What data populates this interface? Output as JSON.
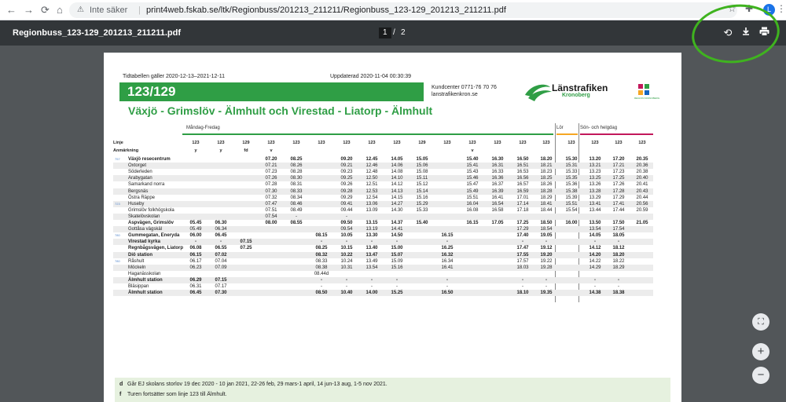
{
  "browser": {
    "back_icon": "←",
    "forward_icon": "→",
    "reload_icon": "⟳",
    "home_icon": "⌂",
    "security_label": "Inte säker",
    "url": "print4web.fskab.se/ltk/Regionbuss/201213_211211/Regionbuss_123-129_201213_211211.pdf",
    "profile_initial": "L"
  },
  "pdf": {
    "title": "Regionbuss_123-129_201213_211211.pdf",
    "page": "1",
    "separator": "/",
    "total": "2"
  },
  "doc": {
    "valid": "Tidtabellen gäller 2020-12-13–2021-12-11",
    "updated": "Uppdaterad 2020-11-04 00:30:39",
    "route": "123/129",
    "title": "Växjö - Grimslöv - Älmhult och Virestad - Liatorp - Älmhult",
    "kundcenter": "Kundcenter 0771-76 70 76",
    "website": "lanstrafikenkron.se",
    "brand": "Länstrafiken",
    "brand_sub": "Kronoberg",
    "region_text": "REGION KRONOBERG",
    "days": [
      "Måndag-Fredag",
      "Lör",
      "Sön- och helgdag"
    ],
    "linje_label": "Linje",
    "anm_label": "Anmärkning",
    "line_numbers": [
      "123",
      "123",
      "129",
      "123",
      "123",
      "123",
      "123",
      "123",
      "123",
      "129",
      "123",
      "123",
      "123",
      "123",
      "123",
      "123",
      "123",
      "123",
      "123"
    ],
    "remarks": [
      "y",
      "y",
      "fd",
      "v",
      "",
      "",
      "",
      "",
      "",
      "",
      "",
      "v",
      "",
      "",
      "",
      "",
      "",
      "",
      ""
    ],
    "stops": [
      {
        "zone": "757",
        "name": "Växjö resecentrum",
        "bold": true,
        "t": [
          "",
          "",
          "",
          "07.20",
          "08.25",
          "",
          "09.20",
          "12.45",
          "14.05",
          "15.05",
          "",
          "15.40",
          "16.30",
          "16.50",
          "18.20",
          "15.30",
          "13.20",
          "17.20",
          "20.35"
        ]
      },
      {
        "zone": "",
        "name": "Oxtorget",
        "bold": false,
        "t": [
          "",
          "",
          "",
          "07.21",
          "08.26",
          "",
          "09.21",
          "12.46",
          "14.06",
          "15.06",
          "",
          "15.41",
          "16.31",
          "16.51",
          "18.21",
          "15.31",
          "13.21",
          "17.21",
          "20.36"
        ]
      },
      {
        "zone": "",
        "name": "Söderleden",
        "bold": false,
        "t": [
          "",
          "",
          "",
          "07.23",
          "08.28",
          "",
          "09.23",
          "12.48",
          "14.08",
          "15.08",
          "",
          "15.43",
          "16.33",
          "16.53",
          "18.23",
          "15.33",
          "13.23",
          "17.23",
          "20.38"
        ]
      },
      {
        "zone": "",
        "name": "Arabygatan",
        "bold": false,
        "t": [
          "",
          "",
          "",
          "07.26",
          "08.30",
          "",
          "09.25",
          "12.50",
          "14.10",
          "15.11",
          "",
          "15.46",
          "16.36",
          "16.56",
          "18.25",
          "15.35",
          "13.25",
          "17.25",
          "20.40"
        ]
      },
      {
        "zone": "",
        "name": "Samarkand norra",
        "bold": false,
        "t": [
          "",
          "",
          "",
          "07.28",
          "08.31",
          "",
          "09.26",
          "12.51",
          "14.12",
          "15.12",
          "",
          "15.47",
          "16.37",
          "16.57",
          "18.26",
          "15.36",
          "13.26",
          "17.26",
          "20.41"
        ]
      },
      {
        "zone": "",
        "name": "Bergsnäs",
        "bold": false,
        "t": [
          "",
          "",
          "",
          "07.30",
          "08.33",
          "",
          "09.28",
          "12.53",
          "14.13",
          "15.14",
          "",
          "15.49",
          "16.39",
          "16.59",
          "18.28",
          "15.38",
          "13.28",
          "17.28",
          "20.43"
        ]
      },
      {
        "zone": "",
        "name": "Östra Räppe",
        "bold": false,
        "t": [
          "",
          "",
          "",
          "07.32",
          "08.34",
          "",
          "09.29",
          "12.54",
          "14.15",
          "15.16",
          "",
          "15.51",
          "16.41",
          "17.01",
          "18.29",
          "15.39",
          "13.29",
          "17.29",
          "20.44"
        ]
      },
      {
        "zone": "723",
        "name": "Huseby",
        "bold": false,
        "t": [
          "",
          "",
          "",
          "07.47",
          "08.46",
          "",
          "09.41",
          "13.06",
          "14.27",
          "15.29",
          "",
          "16.04",
          "16.54",
          "17.14",
          "18.41",
          "15.51",
          "13.41",
          "17.41",
          "20.56"
        ]
      },
      {
        "zone": "",
        "name": "Grimslöv folkhögskola",
        "bold": false,
        "t": [
          "",
          "",
          "",
          "07.51",
          "08.49",
          "",
          "09.44",
          "13.09",
          "14.30",
          "15.33",
          "",
          "16.08",
          "16.58",
          "17.18",
          "18.44",
          "15.54",
          "13.44",
          "17.44",
          "20.59"
        ]
      },
      {
        "zone": "",
        "name": "Skatelövskolan",
        "bold": false,
        "t": [
          "",
          "",
          "",
          "07.54",
          "-",
          "",
          "-",
          "",
          "",
          "",
          "",
          "",
          "",
          "",
          "",
          "",
          "",
          "",
          ""
        ]
      },
      {
        "zone": "",
        "name": "Aspvägen, Grimslöv",
        "bold": true,
        "t": [
          "05.45",
          "06.30",
          "",
          "08.00",
          "08.55",
          "",
          "09.50",
          "13.15",
          "14.37",
          "15.40",
          "",
          "16.15",
          "17.05",
          "17.25",
          "18.50",
          "16.00",
          "13.50",
          "17.50",
          "21.05"
        ]
      },
      {
        "zone": "",
        "name": "Gottåsa vägskäl",
        "bold": false,
        "t": [
          "05.49",
          "06.34",
          "",
          "",
          "",
          "",
          "09.54",
          "13.19",
          "14.41",
          "",
          "",
          "",
          "",
          "17.29",
          "18.54",
          "",
          "13.54",
          "17.54",
          ""
        ]
      },
      {
        "zone": "780",
        "name": "Gummegatan, Eneryda",
        "bold": true,
        "t": [
          "06.00",
          "06.45",
          "",
          "",
          "",
          "08.15",
          "10.05",
          "13.30",
          "14.50",
          "",
          "16.15",
          "",
          "",
          "17.40",
          "19.05",
          "",
          "14.05",
          "18.05",
          ""
        ]
      },
      {
        "zone": "",
        "name": "Virestad kyrka",
        "bold": true,
        "t": [
          "-",
          "-",
          "07.15",
          "",
          "",
          "-",
          "-",
          "-",
          "-",
          "",
          "-",
          "",
          "",
          "-",
          "-",
          "",
          "-",
          "-",
          ""
        ]
      },
      {
        "zone": "",
        "name": "Regnbågsvägen, Liatorp",
        "bold": true,
        "t": [
          "06.08",
          "06.55",
          "07.25",
          "",
          "",
          "08.25",
          "10.15",
          "13.40",
          "15.00",
          "",
          "16.25",
          "",
          "",
          "17.47",
          "19.12",
          "",
          "14.12",
          "18.12",
          ""
        ]
      },
      {
        "zone": "",
        "name": "Diö station",
        "bold": true,
        "t": [
          "06.15",
          "07.02",
          "",
          "",
          "",
          "08.32",
          "10.22",
          "13.47",
          "15.07",
          "",
          "16.32",
          "",
          "",
          "17.55",
          "19.20",
          "",
          "14.20",
          "18.20",
          ""
        ]
      },
      {
        "zone": "780",
        "name": "Råshult",
        "bold": false,
        "t": [
          "06.17",
          "07.04",
          "",
          "",
          "",
          "08.33",
          "10.24",
          "13.49",
          "15.09",
          "",
          "16.34",
          "",
          "",
          "17.57",
          "19.22",
          "",
          "14.22",
          "18.22",
          ""
        ]
      },
      {
        "zone": "",
        "name": "Möckeln",
        "bold": false,
        "t": [
          "06.23",
          "07.09",
          "",
          "",
          "",
          "08.38",
          "10.31",
          "13.54",
          "15.16",
          "",
          "16.41",
          "",
          "",
          "18.03",
          "19.28",
          "",
          "14.29",
          "18.29",
          ""
        ]
      },
      {
        "zone": "",
        "name": "Haganässkolan",
        "bold": false,
        "t": [
          "",
          "",
          "",
          "",
          "",
          "08.44d",
          "",
          "",
          "",
          "",
          "",
          "",
          "",
          "",
          "",
          "",
          "",
          "",
          ""
        ]
      },
      {
        "zone": "",
        "name": "Älmhult station",
        "bold": true,
        "t": [
          "06.29",
          "07.15",
          "",
          "",
          "",
          "-",
          "-",
          "-",
          "-",
          "",
          "-",
          "",
          "",
          "-",
          "-",
          "",
          "-",
          "-",
          ""
        ]
      },
      {
        "zone": "",
        "name": "Bläsippan",
        "bold": false,
        "t": [
          "06.31",
          "07.17",
          "",
          "",
          "",
          "-",
          "-",
          "-",
          "-",
          "",
          "-",
          "",
          "",
          "-",
          "-",
          "",
          "-",
          "-",
          ""
        ]
      },
      {
        "zone": "",
        "name": "Älmhult station",
        "bold": true,
        "t": [
          "06.45",
          "07.30",
          "",
          "",
          "",
          "08.50",
          "10.40",
          "14.00",
          "15.25",
          "",
          "16.50",
          "",
          "",
          "18.10",
          "19.35",
          "",
          "14.38",
          "18.38",
          ""
        ]
      }
    ],
    "notes": [
      {
        "key": "d",
        "text": "Går EJ skolans storlov 19 dec 2020 - 10 jan 2021, 22-26 feb, 29 mars-1 april, 14 jun-13 aug, 1-5 nov 2021."
      },
      {
        "key": "f",
        "text": "Turen fortsätter som linje 123 till Älmhult."
      }
    ]
  },
  "colors": {
    "brand_green": "#2f9e45",
    "lor_orange": "#f5a623",
    "son_red": "#c2185b",
    "highlight_circle": "#3fb31f"
  }
}
